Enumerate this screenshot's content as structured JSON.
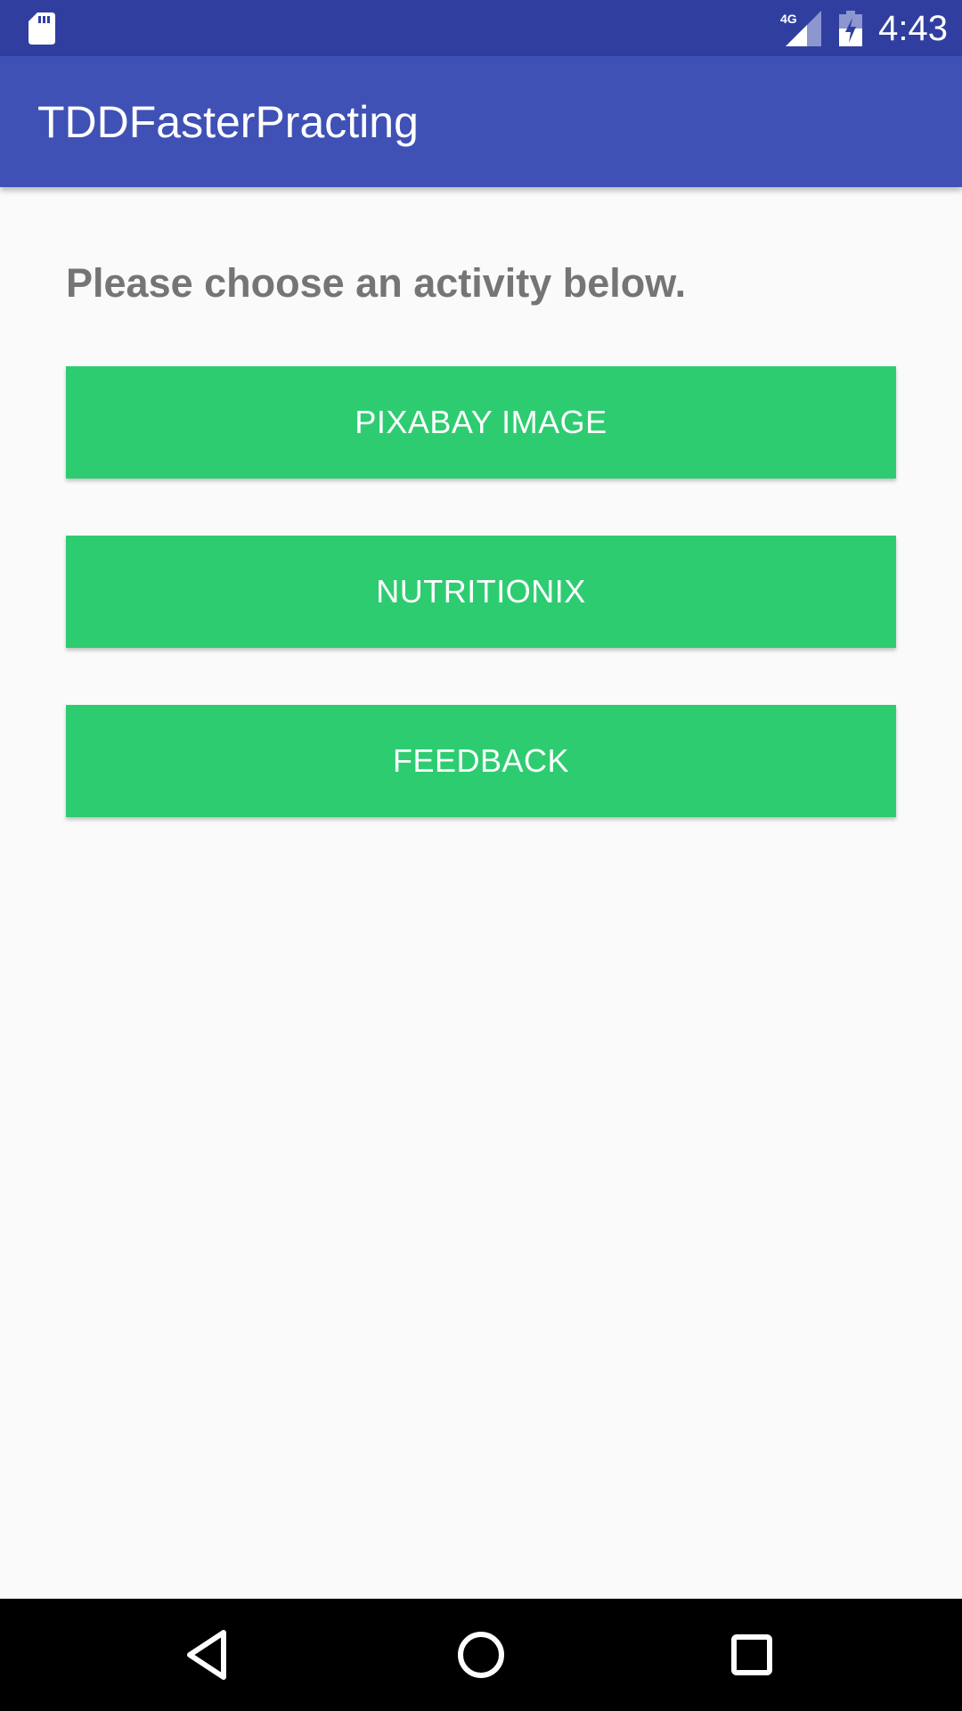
{
  "status_bar": {
    "time": "4:43",
    "network_label": "4G",
    "icons": [
      "sd-card-icon",
      "cellular-signal-icon",
      "battery-charging-icon"
    ]
  },
  "app_bar": {
    "title": "TDDFasterPracting"
  },
  "main": {
    "prompt": "Please choose an activity below.",
    "buttons": [
      {
        "label": "PIXABAY IMAGE"
      },
      {
        "label": "NUTRITIONIX"
      },
      {
        "label": "FEEDBACK"
      }
    ]
  },
  "nav_bar": {
    "icons": [
      "back-icon",
      "home-icon",
      "recents-icon"
    ]
  },
  "colors": {
    "status_bar": "#303f9f",
    "app_bar": "#3f51b5",
    "button": "#2ecc71",
    "prompt_text": "#757575",
    "background": "#fafafa"
  }
}
